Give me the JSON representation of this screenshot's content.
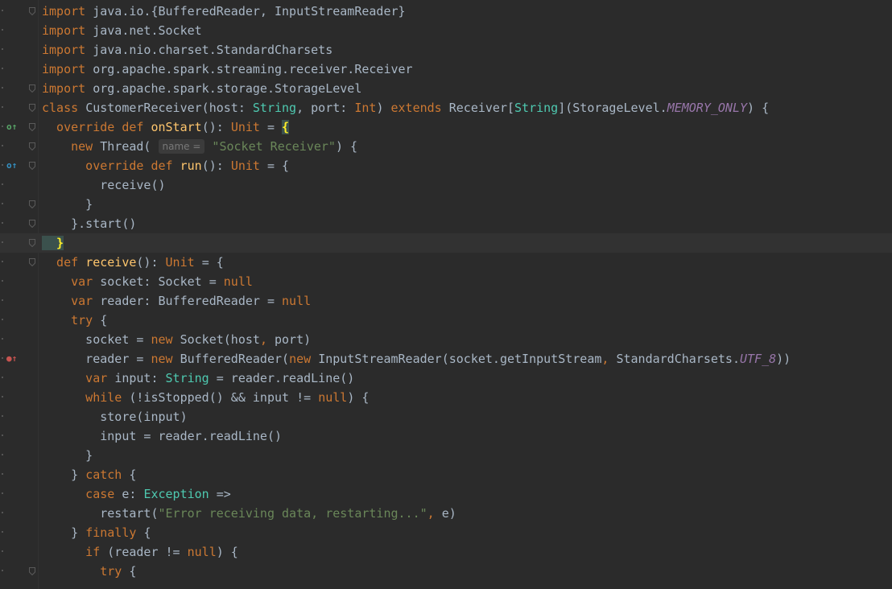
{
  "editor": {
    "colors": {
      "background": "#2b2b2b",
      "keyword": "#cc7832",
      "function": "#ffc66d",
      "plain": "#a9b7c6",
      "string": "#6a8759",
      "type": "#4ec9b0",
      "constant": "#9876aa"
    },
    "lines": [
      {
        "tokens": [
          {
            "c": "kw",
            "t": "import "
          },
          {
            "c": "pl",
            "t": "java.io.{BufferedReader, InputStreamReader}"
          }
        ]
      },
      {
        "tokens": [
          {
            "c": "kw",
            "t": "import "
          },
          {
            "c": "pl",
            "t": "java.net.Socket"
          }
        ]
      },
      {
        "tokens": [
          {
            "c": "kw",
            "t": "import "
          },
          {
            "c": "pl",
            "t": "java.nio.charset.StandardCharsets"
          }
        ]
      },
      {
        "tokens": [
          {
            "c": "kw",
            "t": "import "
          },
          {
            "c": "pl",
            "t": "org.apache.spark.streaming.receiver.Receiver"
          }
        ]
      },
      {
        "tokens": [
          {
            "c": "kw",
            "t": "import "
          },
          {
            "c": "pl",
            "t": "org.apache.spark.storage.StorageLevel"
          }
        ]
      },
      {
        "tokens": [
          {
            "c": "kw",
            "t": "class "
          },
          {
            "c": "pl",
            "t": "CustomerReceiver(host: "
          },
          {
            "c": "ty",
            "t": "String"
          },
          {
            "c": "pl",
            "t": ", port: "
          },
          {
            "c": "kw",
            "t": "Int"
          },
          {
            "c": "pl",
            "t": ") "
          },
          {
            "c": "kw",
            "t": "extends "
          },
          {
            "c": "pl",
            "t": "Receiver["
          },
          {
            "c": "ty",
            "t": "String"
          },
          {
            "c": "pl",
            "t": "](StorageLevel."
          },
          {
            "c": "it",
            "t": "MEMORY_ONLY"
          },
          {
            "c": "pl",
            "t": ") {"
          }
        ]
      },
      {
        "tokens": [
          {
            "c": "kw",
            "t": "  override def "
          },
          {
            "c": "fn",
            "t": "onStart"
          },
          {
            "c": "pl",
            "t": "(): "
          },
          {
            "c": "kw",
            "t": "Unit "
          },
          {
            "c": "pl",
            "t": "= "
          },
          {
            "c": "br",
            "t": "{"
          }
        ]
      },
      {
        "tokens": [
          {
            "c": "kw",
            "t": "    new "
          },
          {
            "c": "pl",
            "t": "Thread( "
          },
          {
            "c": "hint",
            "t": "name ="
          },
          {
            "c": "st",
            "t": " \"Socket Receiver\""
          },
          {
            "c": "pl",
            "t": ") {"
          }
        ]
      },
      {
        "tokens": [
          {
            "c": "kw",
            "t": "      override def "
          },
          {
            "c": "fn",
            "t": "run"
          },
          {
            "c": "pl",
            "t": "(): "
          },
          {
            "c": "kw",
            "t": "Unit "
          },
          {
            "c": "pl",
            "t": "= {"
          }
        ]
      },
      {
        "tokens": [
          {
            "c": "pl",
            "t": "        receive()"
          }
        ]
      },
      {
        "tokens": [
          {
            "c": "pl",
            "t": "      }"
          }
        ]
      },
      {
        "tokens": [
          {
            "c": "pl",
            "t": "    }.start()"
          }
        ]
      },
      {
        "tokens": [
          {
            "c": "br",
            "t": "  }"
          }
        ]
      },
      {
        "tokens": [
          {
            "c": "kw",
            "t": "  def "
          },
          {
            "c": "fn",
            "t": "receive"
          },
          {
            "c": "pl",
            "t": "(): "
          },
          {
            "c": "kw",
            "t": "Unit "
          },
          {
            "c": "pl",
            "t": "= {"
          }
        ]
      },
      {
        "tokens": [
          {
            "c": "kw",
            "t": "    var "
          },
          {
            "c": "pl",
            "t": "socket: Socket = "
          },
          {
            "c": "kw",
            "t": "null"
          }
        ]
      },
      {
        "tokens": [
          {
            "c": "kw",
            "t": "    var "
          },
          {
            "c": "pl",
            "t": "reader: BufferedReader = "
          },
          {
            "c": "kw",
            "t": "null"
          }
        ]
      },
      {
        "tokens": [
          {
            "c": "kw",
            "t": "    try "
          },
          {
            "c": "pl",
            "t": "{"
          }
        ]
      },
      {
        "tokens": [
          {
            "c": "pl",
            "t": "      socket = "
          },
          {
            "c": "kw",
            "t": "new "
          },
          {
            "c": "pl",
            "t": "Socket(host"
          },
          {
            "c": "kw",
            "t": ", "
          },
          {
            "c": "pl",
            "t": "port)"
          }
        ]
      },
      {
        "tokens": [
          {
            "c": "pl",
            "t": "      reader = "
          },
          {
            "c": "kw",
            "t": "new "
          },
          {
            "c": "pl",
            "t": "BufferedReader("
          },
          {
            "c": "kw",
            "t": "new "
          },
          {
            "c": "pl",
            "t": "InputStreamReader(socket.getInputStream"
          },
          {
            "c": "kw",
            "t": ", "
          },
          {
            "c": "pl",
            "t": "StandardCharsets."
          },
          {
            "c": "it",
            "t": "UTF_8"
          },
          {
            "c": "pl",
            "t": "))"
          }
        ]
      },
      {
        "tokens": [
          {
            "c": "kw",
            "t": "      var "
          },
          {
            "c": "pl",
            "t": "input: "
          },
          {
            "c": "ty",
            "t": "String "
          },
          {
            "c": "pl",
            "t": "= reader.readLine()"
          }
        ]
      },
      {
        "tokens": [
          {
            "c": "kw",
            "t": "      while "
          },
          {
            "c": "pl",
            "t": "(!isStopped() && input != "
          },
          {
            "c": "kw",
            "t": "null"
          },
          {
            "c": "pl",
            "t": ") {"
          }
        ]
      },
      {
        "tokens": [
          {
            "c": "pl",
            "t": "        store(input)"
          }
        ]
      },
      {
        "tokens": [
          {
            "c": "pl",
            "t": "        input = reader.readLine()"
          }
        ]
      },
      {
        "tokens": [
          {
            "c": "pl",
            "t": "      }"
          }
        ]
      },
      {
        "tokens": [
          {
            "c": "pl",
            "t": "    } "
          },
          {
            "c": "kw",
            "t": "catch "
          },
          {
            "c": "pl",
            "t": "{"
          }
        ]
      },
      {
        "tokens": [
          {
            "c": "kw",
            "t": "      case "
          },
          {
            "c": "pl",
            "t": "e: "
          },
          {
            "c": "ty",
            "t": "Exception "
          },
          {
            "c": "pl",
            "t": "=>"
          }
        ]
      },
      {
        "tokens": [
          {
            "c": "pl",
            "t": "        restart("
          },
          {
            "c": "st",
            "t": "\"Error receiving data, restarting...\""
          },
          {
            "c": "kw",
            "t": ", "
          },
          {
            "c": "pl",
            "t": "e)"
          }
        ]
      },
      {
        "tokens": [
          {
            "c": "pl",
            "t": "    } "
          },
          {
            "c": "kw",
            "t": "finally "
          },
          {
            "c": "pl",
            "t": "{"
          }
        ]
      },
      {
        "tokens": [
          {
            "c": "kw",
            "t": "      if "
          },
          {
            "c": "pl",
            "t": "(reader != "
          },
          {
            "c": "kw",
            "t": "null"
          },
          {
            "c": "pl",
            "t": ") {"
          }
        ]
      },
      {
        "tokens": [
          {
            "c": "kw",
            "t": "        try "
          },
          {
            "c": "pl",
            "t": "{"
          }
        ]
      }
    ],
    "gutter_icons": [
      {
        "line": 7,
        "kind": "green",
        "name": "override-method-icon"
      },
      {
        "line": 9,
        "kind": "blue",
        "name": "override-method-icon"
      },
      {
        "line": 19,
        "kind": "red",
        "name": "breakpoint-icon"
      }
    ],
    "fold_lines": [
      1,
      5,
      6,
      7,
      8,
      9,
      11,
      12,
      13,
      14,
      30
    ],
    "current_line": 13
  }
}
